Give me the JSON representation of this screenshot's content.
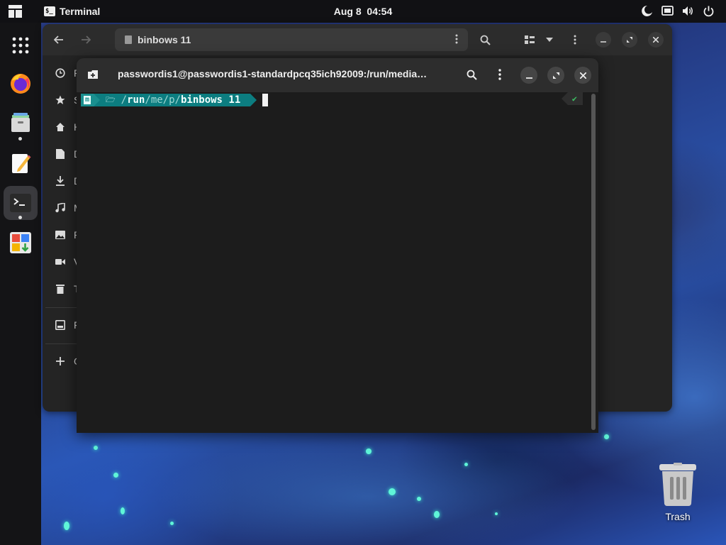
{
  "topbar": {
    "activities_icon": "activities-icon",
    "app_name": "Terminal",
    "clock": "Aug 8  04:54",
    "tray_icons": [
      "night-light-icon",
      "screen-icon",
      "volume-icon",
      "power-icon"
    ]
  },
  "dock": {
    "items": [
      {
        "name": "show-apps",
        "icon": "app-grid-icon",
        "running": false
      },
      {
        "name": "firefox",
        "icon": "firefox-icon",
        "running": false
      },
      {
        "name": "files",
        "icon": "files-icon",
        "running": true
      },
      {
        "name": "text-editor",
        "icon": "text-editor-icon",
        "running": false
      },
      {
        "name": "terminal",
        "icon": "terminal-icon",
        "running": true,
        "active": true
      },
      {
        "name": "software",
        "icon": "software-center-icon",
        "running": false
      }
    ]
  },
  "files_window": {
    "path": "binbows 11",
    "sidebar": [
      {
        "icon": "clock-icon",
        "label": "R"
      },
      {
        "icon": "star-icon",
        "label": "S"
      },
      {
        "icon": "home-icon",
        "label": "H"
      },
      {
        "icon": "document-icon",
        "label": "D"
      },
      {
        "icon": "download-icon",
        "label": "D"
      },
      {
        "icon": "music-icon",
        "label": "M"
      },
      {
        "icon": "picture-icon",
        "label": "P"
      },
      {
        "icon": "video-icon",
        "label": "V"
      },
      {
        "icon": "trash-icon",
        "label": "T"
      },
      {
        "icon": "drive-icon",
        "label": "F"
      },
      {
        "icon": "plus-icon",
        "label": "O"
      }
    ]
  },
  "terminal_window": {
    "title": "passwordis1@passwordis1-standardpcq35ich92009:/run/media…",
    "prompt": {
      "os_glyph": "m",
      "folder_glyph": "🗁",
      "path_parts": [
        "/",
        "run",
        "/",
        "me",
        "/",
        "p",
        "/",
        "binbows 11"
      ],
      "status": "✔"
    }
  },
  "desktop": {
    "trash_label": "Trash"
  }
}
